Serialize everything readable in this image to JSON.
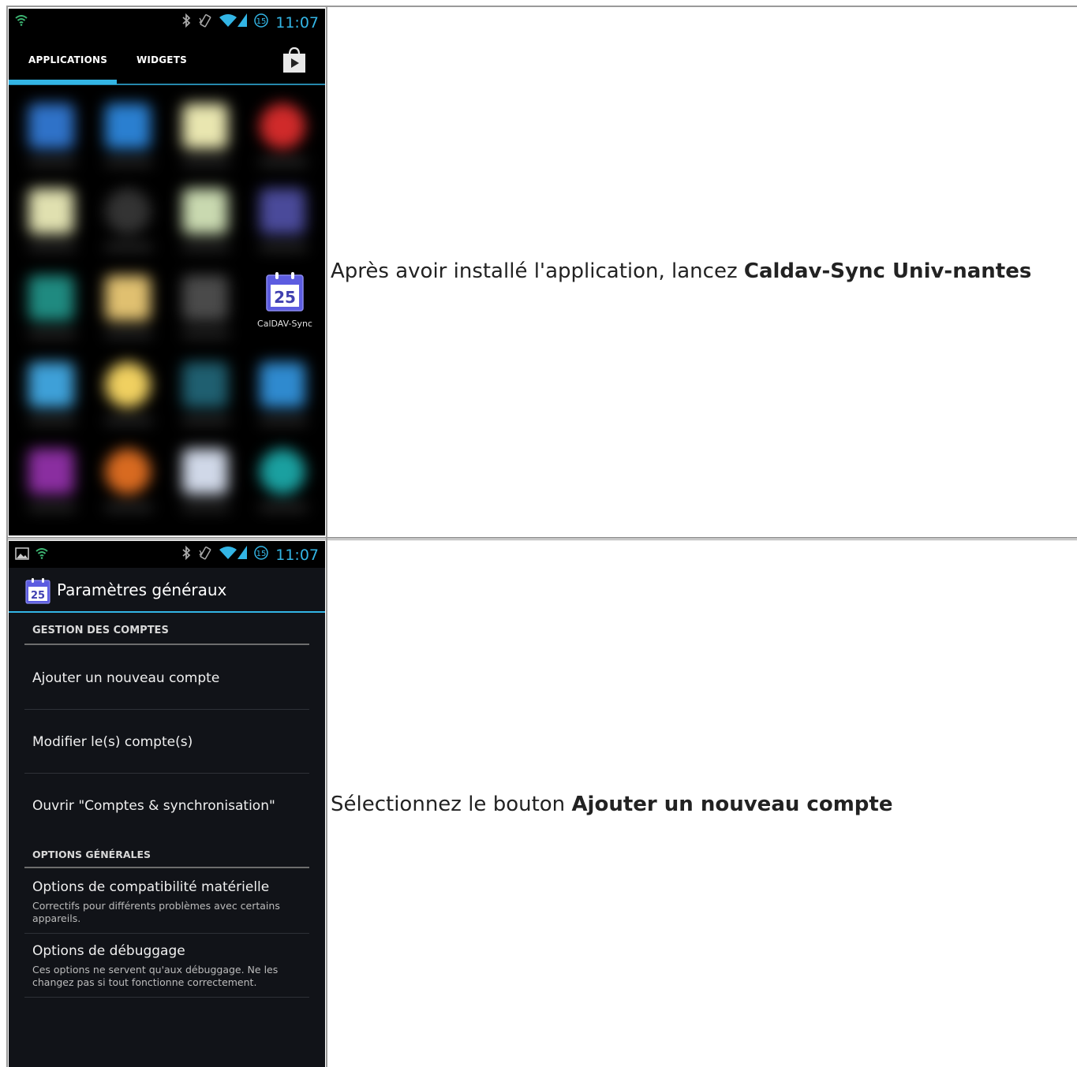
{
  "step1": {
    "caption_prefix": "Après avoir installé l'application, lancez ",
    "caption_bold": "Caldav-Sync Univ-nantes",
    "status_time": "11:07",
    "tabs": {
      "applications": "APPLICATIONS",
      "widgets": "WIDGETS"
    },
    "app_label": "CalDAV-Sync",
    "app_icon_number": "25"
  },
  "step2": {
    "caption_prefix": "Sélectionnez le bouton ",
    "caption_bold": "Ajouter un nouveau compte",
    "status_time": "11:07",
    "title": "Paramètres généraux",
    "title_icon_number": "25",
    "section_accounts": "GESTION DES COMPTES",
    "add_account": "Ajouter un nouveau compte",
    "edit_accounts": "Modifier le(s) compte(s)",
    "open_sync": "Ouvrir \"Comptes & synchronisation\"",
    "section_options": "OPTIONS GÉNÉRALES",
    "hardware_options": "Options de compatibilité matérielle",
    "hardware_options_summary": "Correctifs pour différents problèmes avec certains appareils.",
    "debug_options": "Options de débuggage",
    "debug_options_summary": "Ces options ne servent qu'aux débuggage. Ne les changez pas si tout fonctionne correctement."
  },
  "colors": {
    "holo_blue": "#33b5e5",
    "settings_bg": "#111318",
    "icon_purple": "#5c5ce0"
  }
}
